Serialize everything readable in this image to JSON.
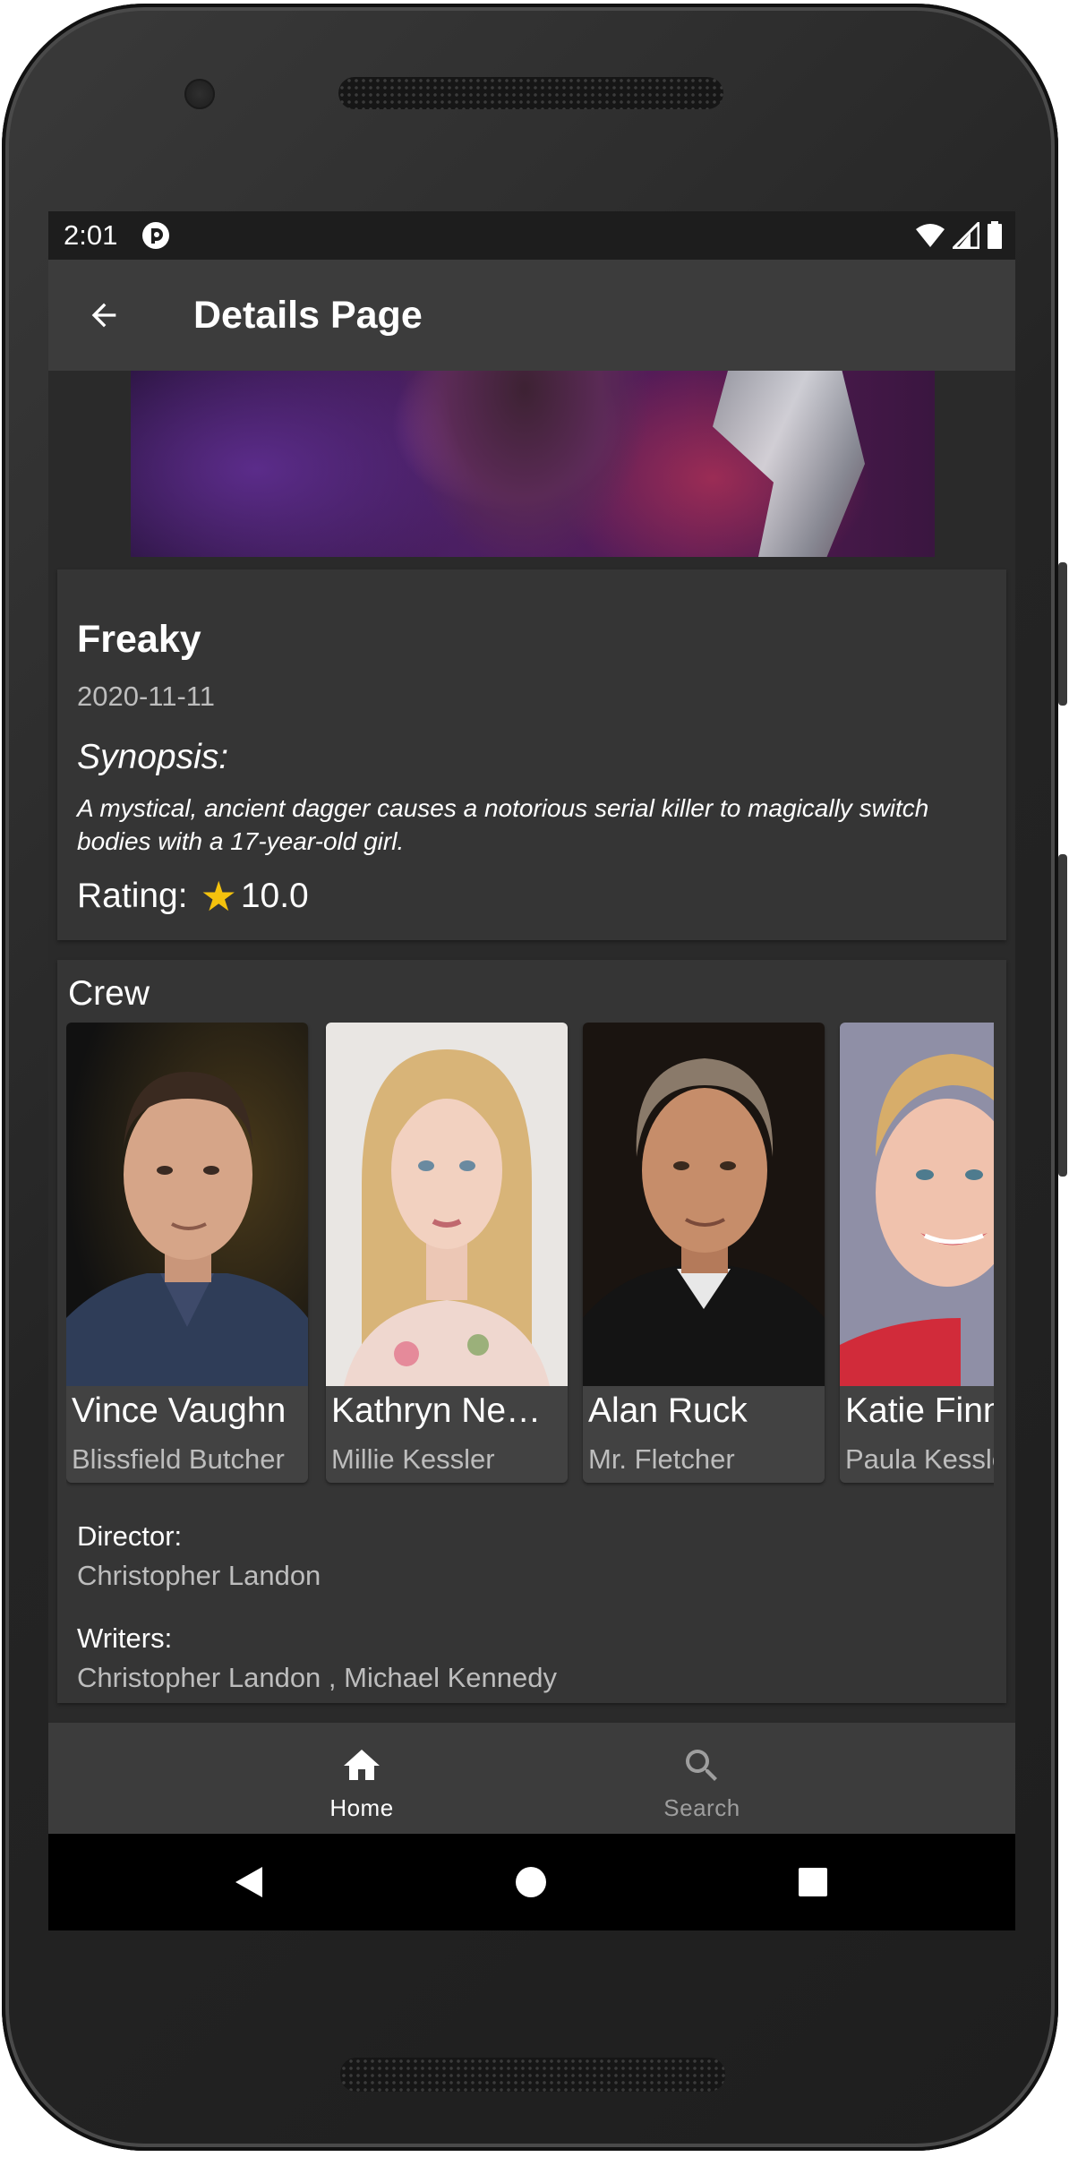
{
  "status": {
    "time": "2:01"
  },
  "appbar": {
    "title": "Details Page"
  },
  "movie": {
    "title": "Freaky",
    "release_date": "2020-11-11",
    "synopsis_label": "Synopsis:",
    "synopsis": "A mystical, ancient dagger causes a notorious serial killer to magically switch bodies with a 17-year-old girl.",
    "rating_label": "Rating:",
    "rating_value": "10.0"
  },
  "crew": {
    "label": "Crew",
    "items": [
      {
        "name": "Vince Vaughn",
        "role": "Blissfield Butcher"
      },
      {
        "name": "Kathryn Ne…",
        "role": "Millie Kessler"
      },
      {
        "name": "Alan Ruck",
        "role": "Mr. Fletcher"
      },
      {
        "name": "Katie Finneran",
        "role": "Paula Kessler"
      }
    ],
    "director_label": "Director:",
    "director": "Christopher Landon",
    "writers_label": "Writers:",
    "writers": "Christopher Landon , Michael Kennedy"
  },
  "nav": {
    "home": "Home",
    "search": "Search"
  },
  "colors": {
    "active_nav": "#ffffff",
    "inactive_nav": "#9e9e9e",
    "star": "#f4c20d",
    "card": "#353535",
    "appbar": "#3c3c3c"
  },
  "icons": [
    "back-arrow-icon",
    "star-icon",
    "home-icon",
    "search-icon",
    "wifi-icon",
    "signal-icon",
    "battery-icon",
    "back-triangle-icon",
    "home-circle-icon",
    "recents-square-icon"
  ]
}
